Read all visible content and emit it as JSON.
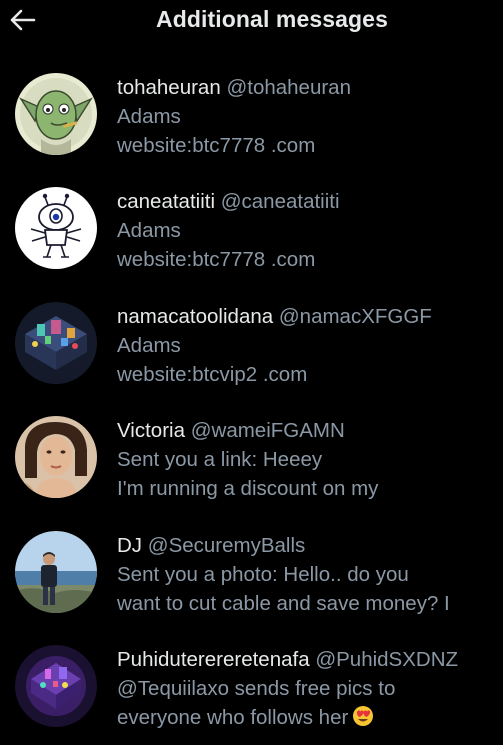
{
  "header": {
    "title": "Additional messages",
    "back_icon": "arrow-left-icon"
  },
  "colors": {
    "background": "#000000",
    "primary_text": "#e7e9ea",
    "secondary_text": "#8b98a5"
  },
  "messages": [
    {
      "name": "tohaheuran",
      "handle": "@tohaheuran",
      "line1": "Adams",
      "line2": "website:btc7778 .com",
      "avatar": "green-goblin-cartoon-avatar"
    },
    {
      "name": "caneatatiiti",
      "handle": "@caneatatiiti",
      "line1": "Adams",
      "line2": "website:btc7778 .com",
      "avatar": "alien-cartoon-avatar"
    },
    {
      "name": "namacatoolidana",
      "handle": "@namacXFGGF",
      "line1": "Adams",
      "line2": "website:btcvip2 .com",
      "avatar": "isometric-game-scene-avatar"
    },
    {
      "name": "Victoria",
      "handle": "@wameiFGAMN",
      "line1": "Sent you a link: Heeey",
      "line2": "I'm running a discount on my",
      "avatar": "woman-portrait-avatar"
    },
    {
      "name": "DJ",
      "handle": "@SecuremyBalls",
      "line1": "Sent you a photo: Hello.. do you",
      "line2": "want to cut cable and save money? I",
      "avatar": "man-by-sea-photo-avatar"
    },
    {
      "name": "Puhiduterereretenafa",
      "handle": "@PuhidSXDNZ",
      "line1": "@Tequiilaxo sends free pics to",
      "line2": "everyone who follows her",
      "line2_emoji": "heart-eyes-emoji",
      "avatar": "purple-game-scene-avatar"
    }
  ]
}
